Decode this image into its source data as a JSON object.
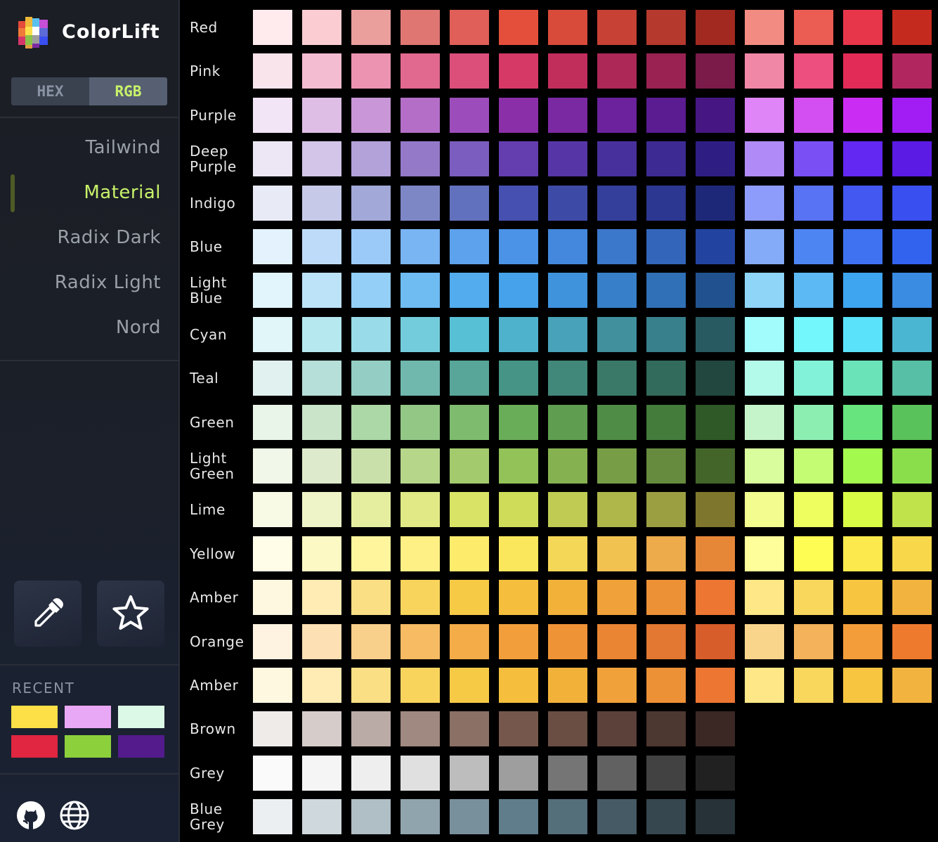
{
  "app": {
    "title": "ColorLift"
  },
  "format_toggle": {
    "options": [
      "HEX",
      "RGB"
    ],
    "selected": "RGB"
  },
  "palettes": [
    {
      "label": "Tailwind"
    },
    {
      "label": "Material",
      "active": true
    },
    {
      "label": "Radix Dark"
    },
    {
      "label": "Radix Light"
    },
    {
      "label": "Nord"
    }
  ],
  "tools": [
    {
      "icon": "eyedropper-icon"
    },
    {
      "icon": "star-icon"
    }
  ],
  "recent": {
    "label": "RECENT",
    "colors": [
      "#fde047",
      "#e9a8f5",
      "#dcf8e6",
      "#e02640",
      "#8cd03c",
      "#541b8c"
    ]
  },
  "footer": {
    "icons": [
      "github-icon",
      "globe-icon"
    ]
  },
  "accent": "#c8f26a",
  "swatch_rows": [
    {
      "name": "Red",
      "colors": [
        "#ffebee",
        "#fbcdd2",
        "#ea9f9c",
        "#df7672",
        "#e05f58",
        "#e44f3b",
        "#d84a3a",
        "#c74134",
        "#b6392e",
        "#a2291f",
        "#f28c82",
        "#eb5c52",
        "#e7364a",
        "#c52a1f"
      ]
    },
    {
      "name": "Pink",
      "colors": [
        "#fae4ec",
        "#f3bcd0",
        "#ec93b2",
        "#e1698f",
        "#db4f7a",
        "#d63966",
        "#c22e5c",
        "#ad2757",
        "#9a2252",
        "#7a1b4a",
        "#f087a6",
        "#ed4f7e",
        "#e22b56",
        "#b2265f"
      ]
    },
    {
      "name": "Purple",
      "colors": [
        "#f2e5f5",
        "#dfbee6",
        "#c996d7",
        "#b46ec7",
        "#9c4dbb",
        "#8a2fa7",
        "#7b29a3",
        "#6b229c",
        "#5b1c92",
        "#461783",
        "#df85f7",
        "#d34ff1",
        "#cb2cf4",
        "#a11df3"
      ]
    },
    {
      "name": "Deep Purple",
      "colors": [
        "#ede7f5",
        "#d2c5e8",
        "#b3a1da",
        "#9479c9",
        "#7b5dbf",
        "#643dae",
        "#5635a6",
        "#48309c",
        "#3d2a93",
        "#2e1e83",
        "#b08bf7",
        "#7a4ff4",
        "#6328f1",
        "#5b1be4"
      ]
    },
    {
      "name": "Indigo",
      "colors": [
        "#e8eaf6",
        "#c6cae8",
        "#a2a9d8",
        "#7e87c6",
        "#6271bd",
        "#4650b0",
        "#3e4ba6",
        "#343f9b",
        "#2c3791",
        "#1e2878",
        "#8d9cfb",
        "#5873f4",
        "#4358f1",
        "#3a4ff0"
      ]
    },
    {
      "name": "Blue",
      "colors": [
        "#e3f2fd",
        "#bedcf9",
        "#9ccaf8",
        "#79b4f3",
        "#5da2ec",
        "#4a93e6",
        "#4388dc",
        "#3b77cb",
        "#3366bb",
        "#2244a0",
        "#84abf8",
        "#4d85f3",
        "#3f72f1",
        "#3263ef"
      ]
    },
    {
      "name": "Light Blue",
      "colors": [
        "#e2f4fc",
        "#bde3f9",
        "#93cff6",
        "#6ebcf2",
        "#53acee",
        "#45a2eb",
        "#3f93dd",
        "#3780c9",
        "#3070b6",
        "#21528f",
        "#8ed5f8",
        "#5cb9f4",
        "#3ea5f1",
        "#3a8be2"
      ]
    },
    {
      "name": "Cyan",
      "colors": [
        "#e0f6f9",
        "#b5e8ef",
        "#99dbe8",
        "#73ccdc",
        "#58c0d5",
        "#4fb2cd",
        "#48a2b9",
        "#40909e",
        "#38808b",
        "#275a61",
        "#a3fcfc",
        "#73f6fc",
        "#5ae2fa",
        "#4bb6d1"
      ]
    },
    {
      "name": "Teal",
      "colors": [
        "#e1f1ef",
        "#b6dfd9",
        "#93cdc3",
        "#70b8ad",
        "#57a699",
        "#469486",
        "#41877a",
        "#3a7968",
        "#326b5b",
        "#21473e",
        "#b3faeb",
        "#82f2d9",
        "#6ae3b9",
        "#56bfa5"
      ]
    },
    {
      "name": "Green",
      "colors": [
        "#e9f5e8",
        "#c9e4c8",
        "#acd7a7",
        "#93c786",
        "#7ebb6e",
        "#6aad59",
        "#5f9e50",
        "#4f8c45",
        "#437c3b",
        "#2f5927",
        "#c6f4ca",
        "#8deeb2",
        "#68e47f",
        "#59c25a"
      ]
    },
    {
      "name": "Light Green",
      "colors": [
        "#f1f8e9",
        "#ddeacb",
        "#c9e0aa",
        "#b6d68a",
        "#a3ca6d",
        "#93c258",
        "#86b151",
        "#779e47",
        "#668b3e",
        "#43652a",
        "#d9fc9d",
        "#c4fd74",
        "#a3f94e",
        "#8ade4c"
      ]
    },
    {
      "name": "Lime",
      "colors": [
        "#f8fae6",
        "#eef4c7",
        "#e5ee9f",
        "#e0e985",
        "#d9e366",
        "#cfdc59",
        "#c0cb53",
        "#afb64a",
        "#9b9f42",
        "#7f762d",
        "#f3fd8f",
        "#eefe5e",
        "#d8fb46",
        "#c0e34c"
      ]
    },
    {
      "name": "Yellow",
      "colors": [
        "#fffde7",
        "#fdf9c4",
        "#fef59c",
        "#fef084",
        "#fdeb6c",
        "#fbe75c",
        "#f5d757",
        "#f2c251",
        "#edab4b",
        "#e68738",
        "#fefe9a",
        "#fdfd54",
        "#fbe94d",
        "#f8d84a"
      ]
    },
    {
      "name": "Amber",
      "colors": [
        "#fef8e1",
        "#feecb4",
        "#fbdf85",
        "#f8d45c",
        "#f7ca46",
        "#f5bf3d",
        "#f2b23a",
        "#f0a139",
        "#ed9136",
        "#ec7632",
        "#fde787",
        "#f9d75c",
        "#f7c540",
        "#f2b43f"
      ]
    },
    {
      "name": "Orange",
      "colors": [
        "#fdf3e0",
        "#fde0b3",
        "#f9cf8c",
        "#f6bb63",
        "#f4ac48",
        "#f29f3b",
        "#ef9337",
        "#e98533",
        "#e27831",
        "#d75d2a",
        "#f9d58b",
        "#f4b25b",
        "#f39d3a",
        "#ee7a2e"
      ]
    },
    {
      "name": "Amber",
      "colors": [
        "#fef8e1",
        "#feecb4",
        "#fbdf85",
        "#f8d45c",
        "#f7ca46",
        "#f5bf3d",
        "#f2b23a",
        "#f0a139",
        "#ed9136",
        "#ec7632",
        "#fde787",
        "#f9d75c",
        "#f7c540",
        "#f2b43f"
      ]
    },
    {
      "name": "Brown",
      "colors": [
        "#efebe9",
        "#d6cdca",
        "#bbaba6",
        "#a08980",
        "#8b7066",
        "#76574c",
        "#6a4e44",
        "#5b413a",
        "#4d3731",
        "#3b2724"
      ]
    },
    {
      "name": "Grey",
      "colors": [
        "#fafafa",
        "#f5f5f5",
        "#eeeeee",
        "#e0e0e0",
        "#bdbdbd",
        "#9e9e9e",
        "#757575",
        "#616161",
        "#424242",
        "#212121"
      ]
    },
    {
      "name": "Blue Grey",
      "colors": [
        "#eceff1",
        "#cfd8dc",
        "#b0bec5",
        "#90a4ae",
        "#78909c",
        "#607d8b",
        "#546e7a",
        "#455a64",
        "#37474f",
        "#263238"
      ]
    }
  ]
}
